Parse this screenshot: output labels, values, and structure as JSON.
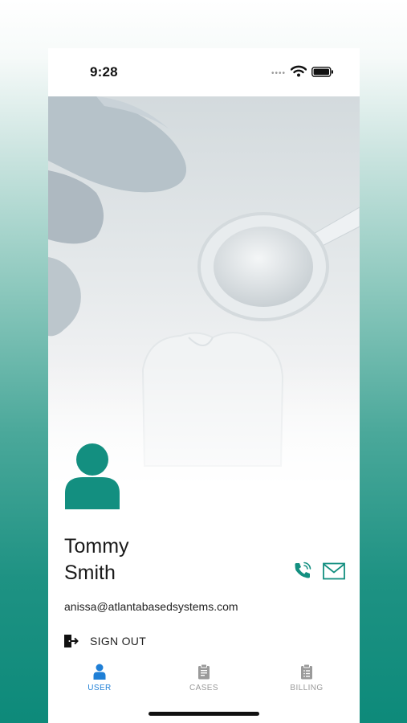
{
  "status_bar": {
    "time": "9:28",
    "signal_icon": "signal-dots-icon",
    "wifi_icon": "wifi-icon",
    "battery_icon": "battery-icon"
  },
  "hero": {
    "image": "dental-mirror-and-tooth-photo"
  },
  "profile": {
    "avatar_icon": "user-avatar-icon",
    "first_name": "Tommy",
    "last_name": "Smith",
    "email": "anissa@atlantabasedsystems.com",
    "call_icon": "phone-icon",
    "mail_icon": "mail-icon"
  },
  "sign_out": {
    "label": "SIGN OUT",
    "icon": "sign-out-icon"
  },
  "tabs": [
    {
      "label": "USER",
      "icon": "user-icon",
      "active": true
    },
    {
      "label": "CASES",
      "icon": "clipboard-icon",
      "active": false
    },
    {
      "label": "BILLING",
      "icon": "billing-icon",
      "active": false
    }
  ],
  "colors": {
    "accent": "#138f80",
    "active_tab": "#1f7fd6",
    "inactive_tab": "#9a9a9a"
  }
}
